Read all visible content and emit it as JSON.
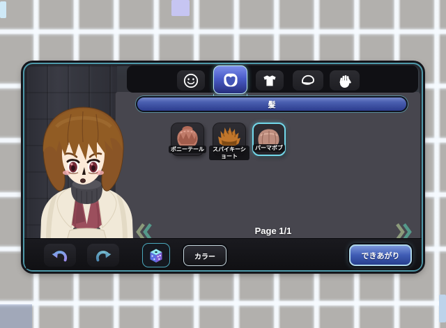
{
  "tabs": [
    {
      "name": "face",
      "icon": "smiley-icon",
      "selected": false
    },
    {
      "name": "hair",
      "icon": "hair-icon",
      "selected": true
    },
    {
      "name": "clothes",
      "icon": "tshirt-icon",
      "selected": false
    },
    {
      "name": "hat",
      "icon": "cap-icon",
      "selected": false
    },
    {
      "name": "hand",
      "icon": "hand-icon",
      "selected": false
    }
  ],
  "category": {
    "title": "髪"
  },
  "items": [
    {
      "label": "ポニーテール",
      "selected": false
    },
    {
      "label": "スパイキーショート",
      "selected": false
    },
    {
      "label": "パーマボブ",
      "selected": true
    }
  ],
  "pagination": {
    "label": "Page 1/1",
    "prev_icon": "double-chevron-left-icon",
    "next_icon": "double-chevron-right-icon"
  },
  "toolbar": {
    "undo_icon": "undo-arrow-icon",
    "redo_icon": "redo-arrow-icon",
    "random_icon": "dice-icon",
    "color_label": "カラー",
    "done_label": "できあがり"
  },
  "colors": {
    "accent_cyan": "#72d8ea",
    "selected_tab_blue": "#4a5cc8",
    "header_blue": "#3c55aa",
    "done_button_blue": "#3f5cb4",
    "panel_bg": "#33343b",
    "content_bg": "#47464e",
    "chevron_olive": "#8c9b7b",
    "chevron_teal": "#55998a"
  }
}
